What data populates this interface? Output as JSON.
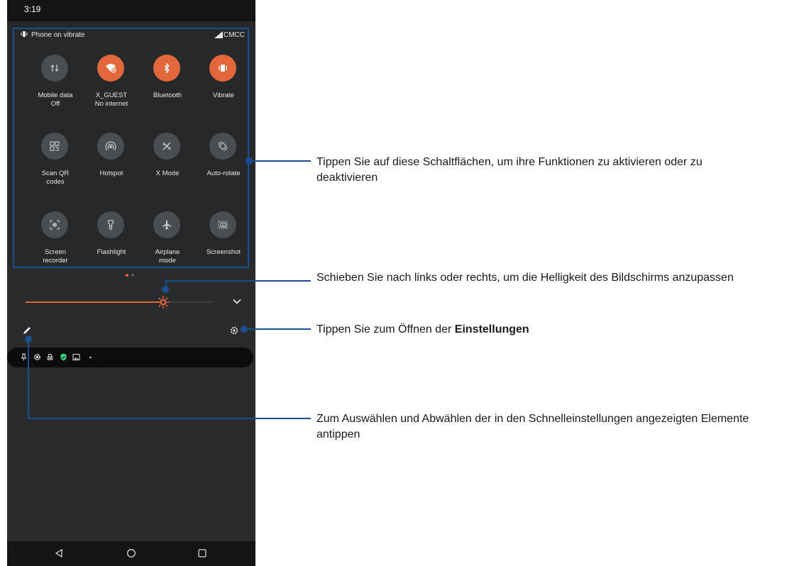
{
  "status_bar": {
    "time": "3:19"
  },
  "quick_settings": {
    "ringer_status": "Phone on vibrate",
    "carrier": "CMCC",
    "tiles": [
      {
        "id": "mobile-data",
        "label_line1": "Mobile data",
        "label_line2": "Off",
        "icon": "mobile-data-icon",
        "active": false
      },
      {
        "id": "wifi",
        "label_line1": "X_GUEST",
        "label_line2": "No internet",
        "icon": "wifi-no-internet-icon",
        "active": true
      },
      {
        "id": "bluetooth",
        "label_line1": "Bluetooth",
        "label_line2": "",
        "icon": "bluetooth-icon",
        "active": true
      },
      {
        "id": "vibrate",
        "label_line1": "Vibrate",
        "label_line2": "",
        "icon": "vibrate-icon",
        "active": true
      },
      {
        "id": "scan-qr",
        "label_line1": "Scan QR",
        "label_line2": "codes",
        "icon": "qr-code-icon",
        "active": false
      },
      {
        "id": "hotspot",
        "label_line1": "Hotspot",
        "label_line2": "",
        "icon": "hotspot-icon",
        "active": false
      },
      {
        "id": "x-mode",
        "label_line1": "X Mode",
        "label_line2": "",
        "icon": "x-mode-icon",
        "active": false
      },
      {
        "id": "auto-rotate",
        "label_line1": "Auto-rotate",
        "label_line2": "",
        "icon": "auto-rotate-icon",
        "active": false
      },
      {
        "id": "screen-recorder",
        "label_line1": "Screen",
        "label_line2": "recorder",
        "icon": "screen-recorder-icon",
        "active": false
      },
      {
        "id": "flashlight",
        "label_line1": "Flashlight",
        "label_line2": "",
        "icon": "flashlight-icon",
        "active": false
      },
      {
        "id": "airplane",
        "label_line1": "Airplane",
        "label_line2": "mode",
        "icon": "airplane-icon",
        "active": false
      },
      {
        "id": "screenshot",
        "label_line1": "Screenshot",
        "label_line2": "",
        "icon": "screenshot-icon",
        "active": false
      }
    ],
    "brightness_level": 0.74,
    "page_indicator": {
      "current": 1,
      "total": 2
    }
  },
  "callouts": {
    "tiles": "Tippen Sie auf diese Schaltflächen, um ihre Funktionen zu aktivieren oder zu deaktivieren",
    "brightness": "Schieben Sie nach links oder rechts, um die Helligkeit des Bildschirms anzupassen",
    "settings_prefix": "Tippen Sie zum Öffnen der ",
    "settings_bold": "Einstellungen",
    "edit": "Zum Auswählen und Abwählen der in den Schnelleinstellungen angezeigten Elemente antippen"
  },
  "colors": {
    "accent": "#e2673b",
    "tile_inactive": "#4b4e51",
    "callout": "#1a4f8f"
  }
}
